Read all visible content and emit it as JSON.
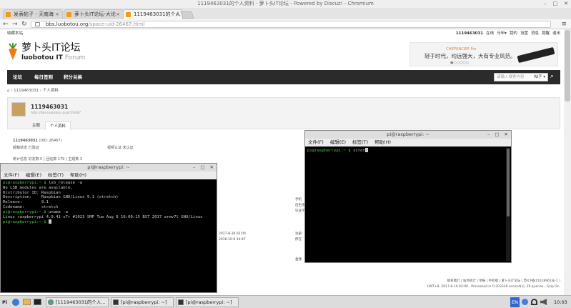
{
  "window_title": "1119463031的个人资料 - 萝卜头IT论坛 - Powered by Discuz! - Chromium",
  "tabs": [
    {
      "label": "发表帖子 - 天南海"
    },
    {
      "label": "萝卜头IT论坛-大论"
    },
    {
      "label": "1119463031的个人"
    }
  ],
  "url_host": "bbs.luobotou.org",
  "url_path": "/space-uid-26467.html",
  "site": {
    "topbar_left": "收藏本站",
    "topbar_links": [
      "1119463031",
      "在线",
      "马甲▾",
      "我的",
      "设置",
      "消息",
      "提醒",
      "退出"
    ],
    "logo_cn": "萝卜头IT论坛",
    "logo_en1": "luobotou IT",
    "logo_en2": "Forum",
    "banner_brand": "CHIPFANCIER Pro",
    "banner_text": "轻于时代，均远强大，大有专业风范。",
    "banner_dots": "●○○○○○",
    "nav": [
      "论坛",
      "每日签到",
      "积分兑换"
    ],
    "search_placeholder": "请输入搜索内容",
    "search_type": "帖子 ▾",
    "breadcrumb": "⌂  ›  1119463031  ›  个人资料",
    "profile_name": "1119463031",
    "profile_url": "http://bbs.luobotou.org/?26467",
    "profile_tabs": [
      "主题",
      "个人资料"
    ],
    "uid_name": "1119463031",
    "uid_text": "(UID: 26467)",
    "row1a": "邮箱状态  已验证",
    "row1b": "视频认证  未认证",
    "row2": "统计信息  好友数 0  |  回帖数 179  |  主题数 3",
    "right_labels": [
      "手机",
      "出生地",
      "毕业学校"
    ],
    "date1": "2017-8-19 02:00",
    "date2": "2016-10-9 10:47",
    "label_reg": "注册",
    "label_last": "所在",
    "label_gold": "金钱",
    "footer1": "联系我们  |  站点统计  |  举报  |  手机版  |  萝卜头IT论坛 ( 苏ICP备15018961号-1 )",
    "footer2": "GMT+8, 2017-8-19 02:00 , Processed in 0.203326 second(s), 29 queries , Gzip On."
  },
  "terminal_small": {
    "title": "pi@raspberrypi: ~",
    "menu": [
      "文件(F)",
      "编辑(E)",
      "标签(T)",
      "帮助(H)"
    ],
    "lines": [
      {
        "prompt": "pi@raspberrypi:~ $",
        "cmd": " lsb_release -a"
      },
      {
        "prompt": "",
        "cmd": "No LSB modules are available."
      },
      {
        "prompt": "",
        "cmd": "Distributor ID:\tRaspbian"
      },
      {
        "prompt": "",
        "cmd": "Description:\tRaspbian GNU/Linux 9.1 (stretch)"
      },
      {
        "prompt": "",
        "cmd": "Release:\t9.1"
      },
      {
        "prompt": "",
        "cmd": "Codename:\tstretch"
      },
      {
        "prompt": "pi@raspberrypi:~ $",
        "cmd": " uname -a"
      },
      {
        "prompt": "",
        "cmd": "Linux raspberrypi 4.9.41-v7+ #1023 SMP Tue Aug 8 16:00:15 BST 2017 armv7l GNU/Linux"
      },
      {
        "prompt": "pi@raspberrypi:~ $",
        "cmd": " "
      }
    ]
  },
  "terminal_big": {
    "title": "pi@raspberrypi: ~",
    "menu": [
      "文件(F)",
      "编辑(E)",
      "标签(T)",
      "帮助(H)"
    ],
    "lines": [
      {
        "prompt": "pi@raspberrypi:~ $",
        "cmd": " scrot"
      }
    ]
  },
  "taskbar": {
    "menu": "Pi",
    "tasks": [
      "[1119463031的个人...",
      "[pi@raspberrypi: ~]",
      "[pi@raspberrypi: ~]"
    ],
    "lang": "EN",
    "clock": "10:03"
  },
  "colors": {
    "accent": "#f39c12",
    "prompt_green": "#44cc44",
    "nav_bg": "#2b2b2b"
  }
}
